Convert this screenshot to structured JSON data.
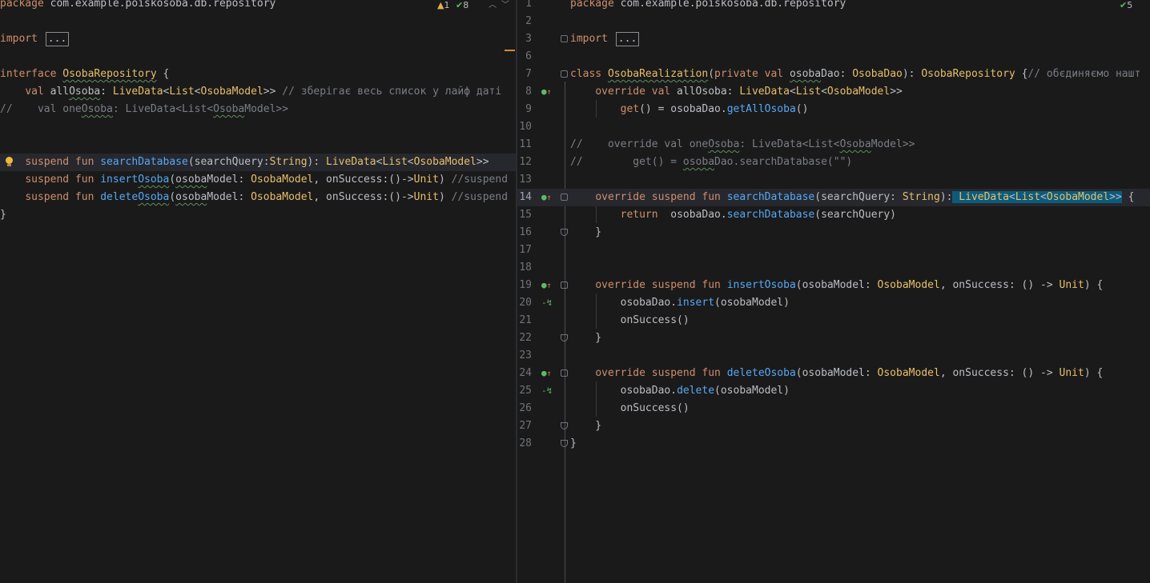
{
  "left_editor": {
    "status": {
      "warnings": "1",
      "ok_count": "8"
    },
    "lines": [
      "package com.example.poiskosoba.db.repository",
      "",
      "import ...",
      "",
      "interface OsobaRepository {",
      "    val allOsoba: LiveData<List<OsobaModel>> // зберігає весь список у лайф даті",
      "//    val oneOsoba: LiveData<List<OsobaModel>>",
      "",
      "",
      "    suspend fun searchDatabase(searchQuery:String): LiveData<List<OsobaModel>>",
      "    suspend fun insertOsoba(osobaModel: OsobaModel, onSuccess:()->Unit) //suspend",
      "    suspend fun deleteOsoba(osobaModel: OsobaModel, onSuccess:()->Unit) //suspend",
      "}"
    ]
  },
  "right_editor": {
    "status": {
      "ok_count": "5"
    },
    "line_numbers": [
      "1",
      "2",
      "3",
      "6",
      "7",
      "8",
      "9",
      "10",
      "11",
      "12",
      "13",
      "14",
      "15",
      "16",
      "17",
      "18",
      "19",
      "20",
      "21",
      "22",
      "23",
      "24",
      "25",
      "26",
      "27",
      "28"
    ],
    "lines": [
      "package com.example.poiskosoba.db.repository",
      "",
      "import ...",
      "",
      "class OsobaRealization(private val osobaDao: OsobaDao): OsobaRepository {// обєдиняємо нашт",
      "    override val allOsoba: LiveData<List<OsobaModel>>",
      "        get() = osobaDao.getAllOsoba()",
      "",
      "//    override val oneOsoba: LiveData<List<OsobaModel>>",
      "//        get() = osobaDao.searchDatabase(\"\")",
      "",
      "    override suspend fun searchDatabase(searchQuery: String): LiveData<List<OsobaModel>> {",
      "        return  osobaDao.searchDatabase(searchQuery)",
      "    }",
      "",
      "",
      "    override suspend fun insertOsoba(osobaModel: OsobaModel, onSuccess: () -> Unit) {",
      "        osobaDao.insert(osobaModel)",
      "        onSuccess()",
      "    }",
      "",
      "    override suspend fun deleteOsoba(osobaModel: OsobaModel, onSuccess: () -> Unit) {",
      "        osobaDao.delete(osobaModel)",
      "        onSuccess()",
      "    }",
      "}"
    ]
  },
  "colors": {
    "background": "#1a1a1a",
    "keyword": "#cf8e6d",
    "type": "#e8bf6a",
    "function": "#56a8f5",
    "comment": "#7a7e85",
    "selection": "#0c5b7c"
  },
  "icons": [
    "warning-icon",
    "check-icon",
    "chevron-up-icon",
    "chevron-down-icon",
    "lightbulb-icon",
    "implements-icon",
    "override-icon",
    "fold-icon"
  ]
}
